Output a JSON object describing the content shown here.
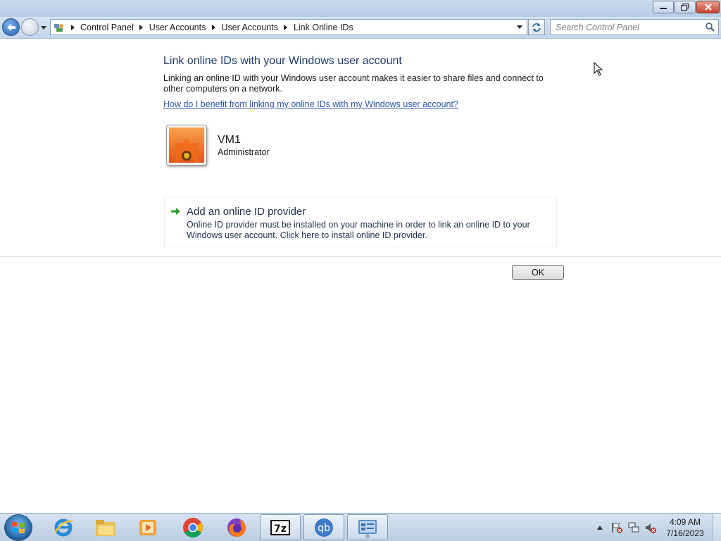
{
  "window": {
    "controls": {
      "minimize_icon": "minimize-icon",
      "maximize_icon": "restore-icon",
      "close_icon": "close-icon"
    }
  },
  "navbar": {
    "breadcrumbs": [
      "Control Panel",
      "User Accounts",
      "User Accounts",
      "Link Online IDs"
    ],
    "search": {
      "placeholder": "Search Control Panel",
      "value": ""
    }
  },
  "content": {
    "title": "Link online IDs with your Windows user account",
    "description": "Linking an online ID with your Windows user account makes it easier to share files and connect to other computers on a network.",
    "help_link": "How do I benefit from linking my online IDs with my Windows user account?",
    "user": {
      "name": "VM1",
      "role": "Administrator"
    },
    "provider": {
      "title": "Add an online ID provider",
      "description": "Online ID provider must be installed on your machine in order to link an online ID to your Windows user account. Click here to install online ID provider."
    },
    "ok_label": "OK"
  },
  "taskbar": {
    "apps": [
      {
        "name": "internet-explorer",
        "icon": "ie-icon",
        "active": false
      },
      {
        "name": "file-explorer",
        "icon": "folder-icon",
        "active": false
      },
      {
        "name": "media-player",
        "icon": "media-icon",
        "active": false
      },
      {
        "name": "chrome",
        "icon": "chrome-icon",
        "active": false
      },
      {
        "name": "firefox",
        "icon": "firefox-icon",
        "active": false
      },
      {
        "name": "7-zip",
        "icon": "7zip-icon",
        "label": "7z",
        "active": true
      },
      {
        "name": "qbittorrent",
        "icon": "qbittorrent-icon",
        "label": "qb",
        "active": true
      },
      {
        "name": "control-panel",
        "icon": "control-panel-icon",
        "active": true
      }
    ],
    "clock": {
      "time": "4:09 AM",
      "date": "7/16/2023"
    }
  },
  "colors": {
    "title_text": "#1e3a6e",
    "link": "#2a56a8",
    "provider_arrow": "#2f9e2f"
  }
}
